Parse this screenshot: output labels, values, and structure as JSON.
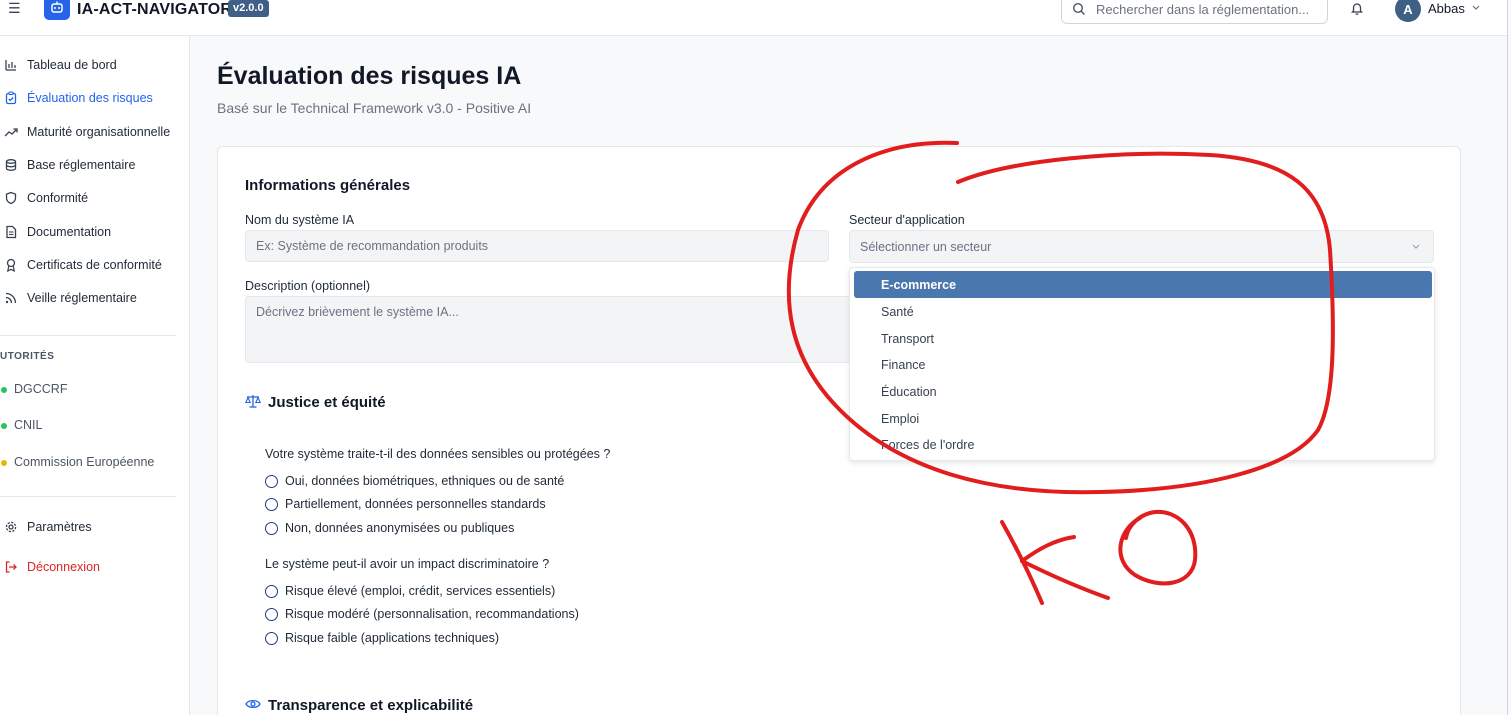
{
  "topbar": {
    "brand": "IA-ACT-NAVIGATOR",
    "version": "v2.0.0",
    "search_placeholder": "Rechercher dans la réglementation...",
    "user_initial": "A",
    "user_name": "Abbas"
  },
  "sidebar": {
    "items": [
      {
        "label": "Tableau de bord",
        "icon": "bar-chart-icon"
      },
      {
        "label": "Évaluation des risques",
        "icon": "clipboard-check-icon"
      },
      {
        "label": "Maturité organisationnelle",
        "icon": "trending-up-icon"
      },
      {
        "label": "Base réglementaire",
        "icon": "database-icon"
      },
      {
        "label": "Conformité",
        "icon": "shield-icon"
      },
      {
        "label": "Documentation",
        "icon": "document-icon"
      },
      {
        "label": "Certificats de conformité",
        "icon": "award-icon"
      },
      {
        "label": "Veille réglementaire",
        "icon": "rss-icon"
      }
    ],
    "authorities_label": "UTORITÉS",
    "authorities": [
      {
        "label": "DGCCRF",
        "color": "#22c55e"
      },
      {
        "label": "CNIL",
        "color": "#22c55e"
      },
      {
        "label": "Commission Européenne",
        "color": "#eab308"
      }
    ],
    "settings_label": "Paramètres",
    "logout_label": "Déconnexion"
  },
  "main": {
    "title": "Évaluation des risques IA",
    "subtitle": "Basé sur le Technical Framework v3.0 - Positive AI",
    "general": {
      "title": "Informations générales",
      "name_label": "Nom du système IA",
      "name_placeholder": "Ex: Système de recommandation produits",
      "sector_label": "Secteur d'application",
      "sector_placeholder": "Sélectionner un secteur",
      "sector_options": [
        "E-commerce",
        "Santé",
        "Transport",
        "Finance",
        "Éducation",
        "Emploi",
        "Forces de l'ordre"
      ],
      "sector_highlighted": "E-commerce",
      "description_label": "Description (optionnel)",
      "description_placeholder": "Décrivez brièvement le système IA..."
    },
    "justice": {
      "title": "Justice et équité",
      "q1": "Votre système traite-t-il des données sensibles ou protégées ?",
      "q1_options": [
        "Oui, données biométriques, ethniques ou de santé",
        "Partiellement, données personnelles standards",
        "Non, données anonymisées ou publiques"
      ],
      "q2": "Le système peut-il avoir un impact discriminatoire ?",
      "q2_options": [
        "Risque élevé (emploi, crédit, services essentiels)",
        "Risque modéré (personnalisation, recommandations)",
        "Risque faible (applications techniques)"
      ]
    },
    "transparency": {
      "title": "Transparence et explicabilité"
    }
  },
  "annotation": {
    "text": "KO",
    "color": "#e11d1d"
  }
}
